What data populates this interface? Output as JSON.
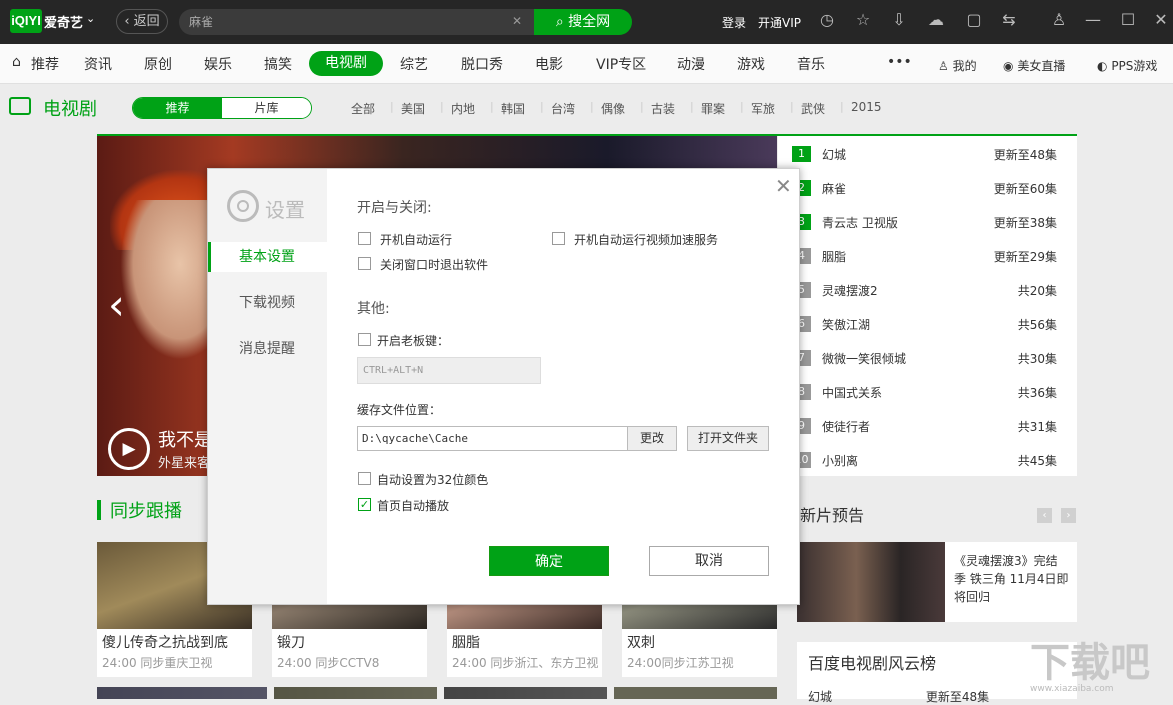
{
  "app": {
    "logo": "iQIYI",
    "brand": "爱奇艺",
    "back": "返回"
  },
  "search": {
    "value": "麻雀",
    "button": "搜全网"
  },
  "toolbar": {
    "login": "登录",
    "vip": "开通VIP"
  },
  "nav": {
    "items": [
      "推荐",
      "资讯",
      "原创",
      "娱乐",
      "搞笑",
      "电视剧",
      "综艺",
      "脱口秀",
      "电影",
      "VIP专区",
      "动漫",
      "游戏",
      "音乐"
    ],
    "active": "电视剧",
    "more": "•••",
    "mine": "我的",
    "live": "美女直播",
    "games": "PPS游戏"
  },
  "section": {
    "title": "电视剧",
    "toggle": [
      "推荐",
      "片库"
    ],
    "categories": [
      "全部",
      "美国",
      "内地",
      "韩国",
      "台湾",
      "偶像",
      "古装",
      "罪案",
      "军旅",
      "武侠",
      "2015"
    ]
  },
  "banner": {
    "title": "我不是",
    "subtitle": "外星来客"
  },
  "rank": [
    {
      "n": "1",
      "name": "幻城",
      "status": "更新至48集"
    },
    {
      "n": "2",
      "name": "麻雀",
      "status": "更新至60集"
    },
    {
      "n": "3",
      "name": "青云志 卫视版",
      "status": "更新至38集"
    },
    {
      "n": "4",
      "name": "胭脂",
      "status": "更新至29集"
    },
    {
      "n": "5",
      "name": "灵魂摆渡2",
      "status": "共20集"
    },
    {
      "n": "6",
      "name": "笑傲江湖",
      "status": "共56集"
    },
    {
      "n": "7",
      "name": "微微一笑很倾城",
      "status": "共30集"
    },
    {
      "n": "8",
      "name": "中国式关系",
      "status": "共36集"
    },
    {
      "n": "9",
      "name": "使徒行者",
      "status": "共31集"
    },
    {
      "n": "10",
      "name": "小别离",
      "status": "共45集"
    }
  ],
  "sync": {
    "title": "同步跟播",
    "cards": [
      {
        "title": "傻儿传奇之抗战到底",
        "sub": "24:00 同步重庆卫视"
      },
      {
        "title": "锻刀",
        "sub": "24:00 同步CCTV8"
      },
      {
        "title": "胭脂",
        "sub": "24:00 同步浙江、东方卫视"
      },
      {
        "title": "双刺",
        "sub": "24:00同步江苏卫视"
      }
    ]
  },
  "preview": {
    "title": "新片预告",
    "text": "《灵魂摆渡3》完结季 铁三角 11月4日即将回归"
  },
  "baidu": {
    "title": "百度电视剧风云榜",
    "row_name": "幻城",
    "row_status": "更新至48集"
  },
  "watermark": {
    "text": "下载吧",
    "url": "www.xiazaiba.com"
  },
  "dialog": {
    "title": "设置",
    "tabs": [
      "基本设置",
      "下载视频",
      "消息提醒"
    ],
    "section_startup": "开启与关闭:",
    "opt_autostart": "开机自动运行",
    "opt_accel": "开机自动运行视频加速服务",
    "opt_exit": "关闭窗口时退出软件",
    "section_other": "其他:",
    "opt_bosskey": "开启老板键：",
    "hotkey": "CTRL+ALT+N",
    "cache_label": "缓存文件位置：",
    "cache_path": "D:\\qycache\\Cache",
    "change": "更改",
    "open_folder": "打开文件夹",
    "opt_32bit": "自动设置为32位颜色",
    "opt_autoplay": "首页自动播放",
    "ok": "确定",
    "cancel": "取消"
  },
  "colors": {
    "accent": "#00a216",
    "titlebar": "#262626"
  }
}
